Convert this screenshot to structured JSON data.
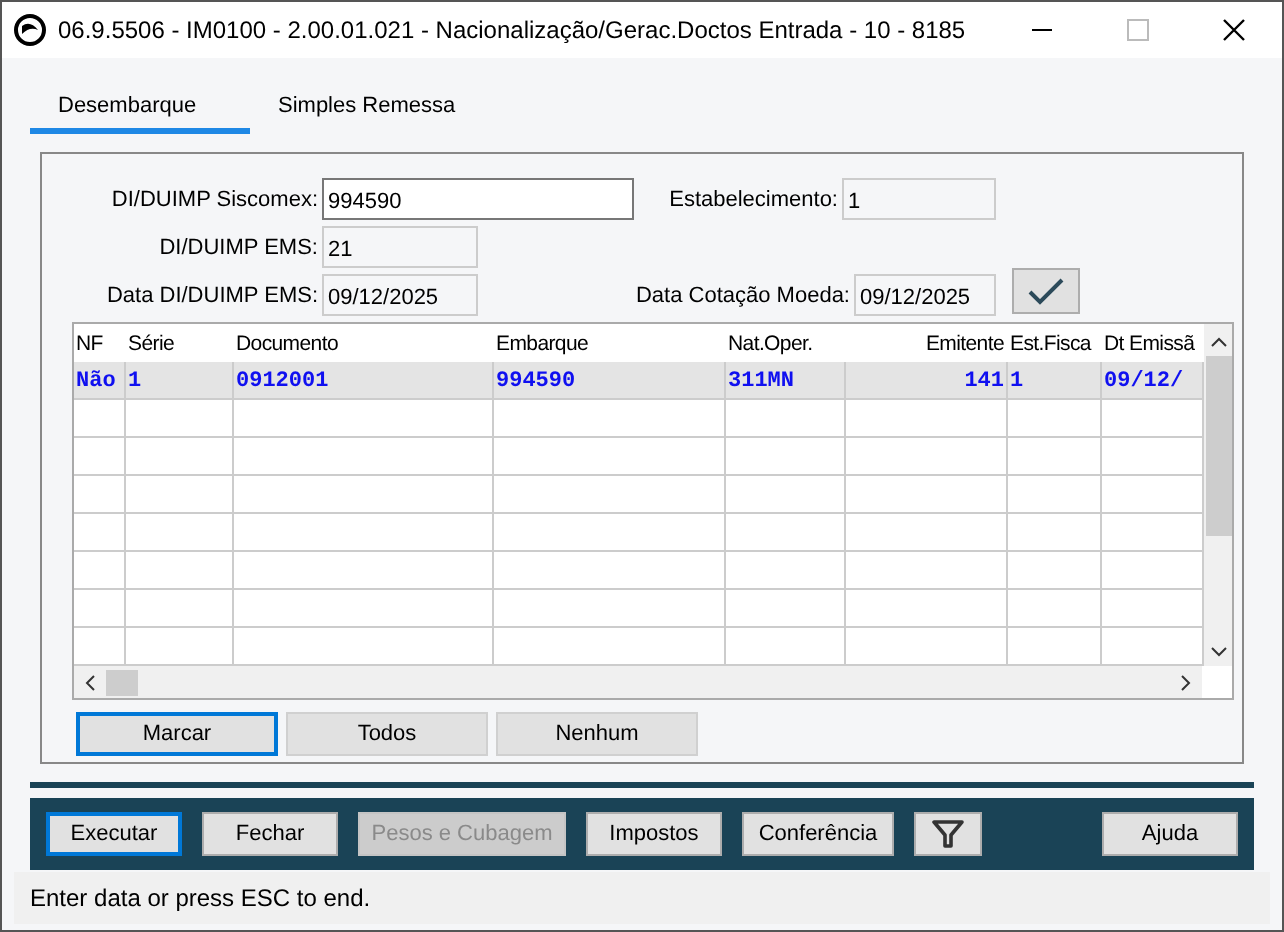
{
  "window": {
    "title": "06.9.5506 - IM0100 - 2.00.01.021 - Nacionalização/Gerac.Doctos Entrada - 10 - 8185"
  },
  "tabs": [
    {
      "label": "Desembarque",
      "selected": true
    },
    {
      "label": "Simples Remessa",
      "selected": false
    }
  ],
  "form": {
    "siscomex": {
      "label": "DI/DUIMP Siscomex:",
      "value": "994590"
    },
    "estabelecimento": {
      "label": "Estabelecimento:",
      "value": "1"
    },
    "ems": {
      "label": "DI/DUIMP EMS:",
      "value": "21"
    },
    "data_ems": {
      "label": "Data DI/DUIMP EMS:",
      "value": "09/12/2025"
    },
    "data_cotacao": {
      "label": "Data Cotação Moeda:",
      "value": "09/12/2025"
    }
  },
  "table": {
    "columns": [
      "NF",
      "Série",
      "Documento",
      "Embarque",
      "Nat.Oper.",
      "Emitente",
      "Est.Fisca",
      "Dt Emissã"
    ],
    "rows": [
      {
        "selected": true,
        "cells": [
          "Não",
          "1",
          "0912001",
          "994590",
          "311MN",
          "141",
          "1",
          "09/12/"
        ]
      }
    ]
  },
  "selection_buttons": [
    {
      "label": "Marcar",
      "focused": true
    },
    {
      "label": "Todos",
      "focused": false
    },
    {
      "label": "Nenhum",
      "focused": false
    }
  ],
  "toolbar": [
    {
      "kind": "button",
      "label": "Executar",
      "focused": true,
      "disabled": false
    },
    {
      "kind": "button",
      "label": "Fechar",
      "focused": false,
      "disabled": false
    },
    {
      "kind": "button",
      "label": "Pesos e Cubagem",
      "focused": false,
      "disabled": true
    },
    {
      "kind": "button",
      "label": "Impostos",
      "focused": false,
      "disabled": false
    },
    {
      "kind": "button",
      "label": "Conferência",
      "focused": false,
      "disabled": false
    },
    {
      "kind": "filter",
      "focused": false,
      "disabled": false
    },
    {
      "kind": "spacer"
    },
    {
      "kind": "button",
      "label": "Ajuda",
      "focused": false,
      "disabled": false
    }
  ],
  "status_bar": "Enter data or press ESC to end."
}
